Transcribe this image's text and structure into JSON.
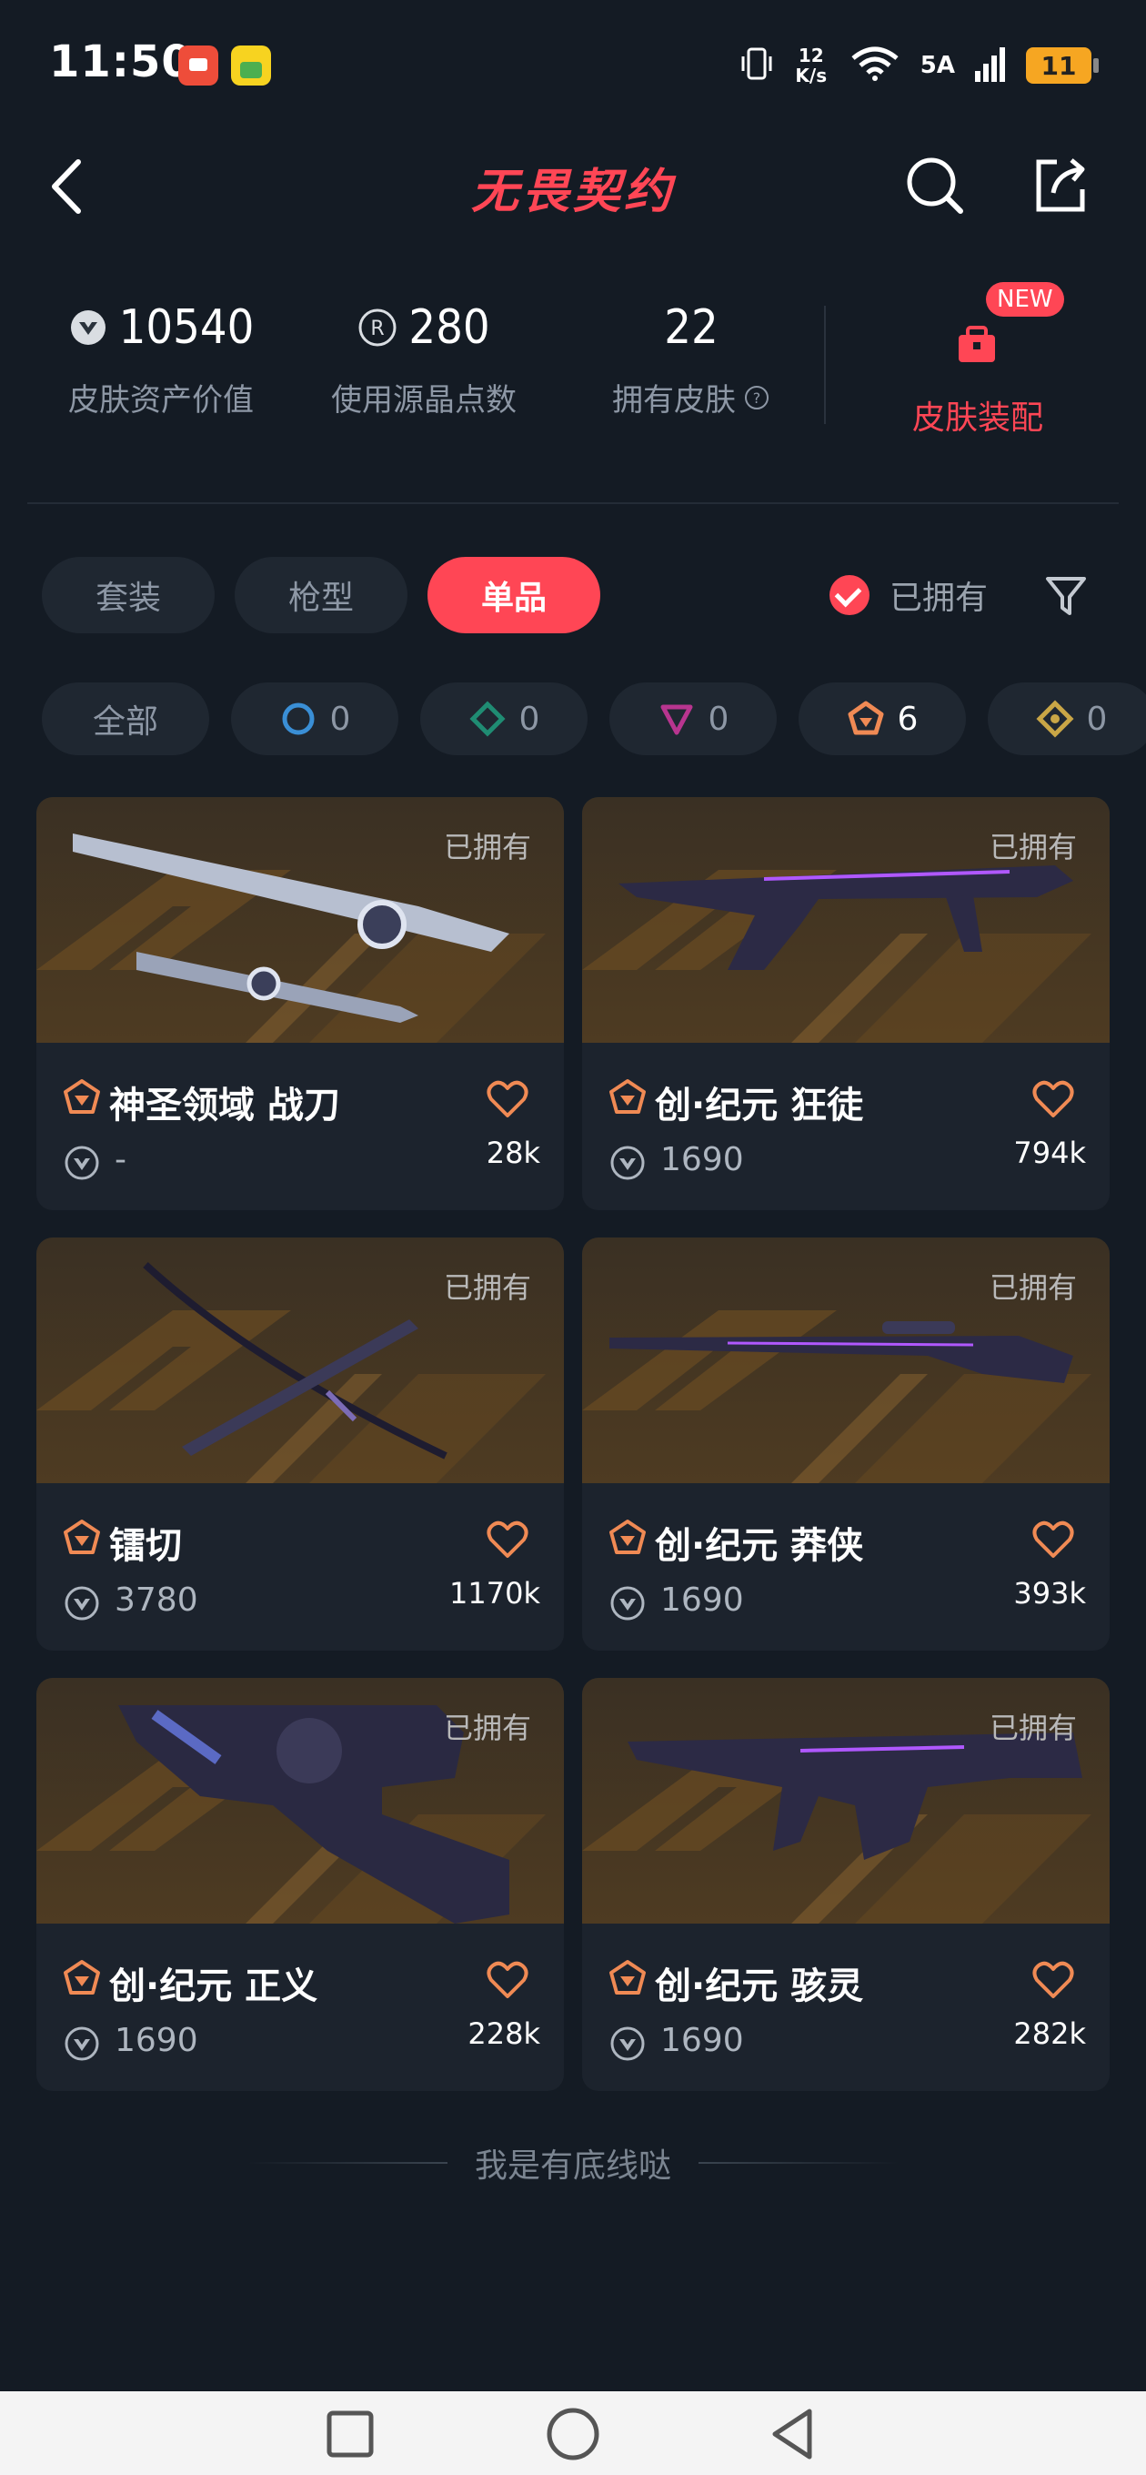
{
  "status_bar": {
    "time": "11:50",
    "network_speed": "12 K/s",
    "signal_label": "5A",
    "battery": "11"
  },
  "header": {
    "title": "无畏契约"
  },
  "stats": [
    {
      "value": "10540",
      "label": "皮肤资产价值"
    },
    {
      "value": "280",
      "label": "使用源晶点数"
    },
    {
      "value": "22",
      "label": "拥有皮肤"
    }
  ],
  "equip": {
    "badge": "NEW",
    "label": "皮肤装配"
  },
  "tabs": [
    {
      "label": "套装"
    },
    {
      "label": "枪型"
    },
    {
      "label": "单品",
      "active": true
    }
  ],
  "owned_filter": {
    "label": "已拥有",
    "checked": true
  },
  "tier_chips": [
    {
      "label": "全部"
    },
    {
      "count": "0",
      "color": "#3a8fd6"
    },
    {
      "count": "0",
      "color": "#1f8c73"
    },
    {
      "count": "0",
      "color": "#b8358f"
    },
    {
      "count": "6",
      "color": "#f08a54"
    },
    {
      "count": "0",
      "color": "#c9a646"
    }
  ],
  "cards": [
    {
      "owned": "已拥有",
      "name": "神圣领域 战刀",
      "price": "-",
      "likes": "28k"
    },
    {
      "owned": "已拥有",
      "name": "创·纪元 狂徒",
      "price": "1690",
      "likes": "794k"
    },
    {
      "owned": "已拥有",
      "name": "镭切",
      "price": "3780",
      "likes": "1170k"
    },
    {
      "owned": "已拥有",
      "name": "创·纪元 莽侠",
      "price": "1690",
      "likes": "393k"
    },
    {
      "owned": "已拥有",
      "name": "创·纪元 正义",
      "price": "1690",
      "likes": "228k"
    },
    {
      "owned": "已拥有",
      "name": "创·纪元 骇灵",
      "price": "1690",
      "likes": "282k"
    }
  ],
  "footer_text": "我是有底线哒",
  "colors": {
    "accent": "#ff4655",
    "background": "#141b24",
    "tier_premium": "#f08a54"
  }
}
